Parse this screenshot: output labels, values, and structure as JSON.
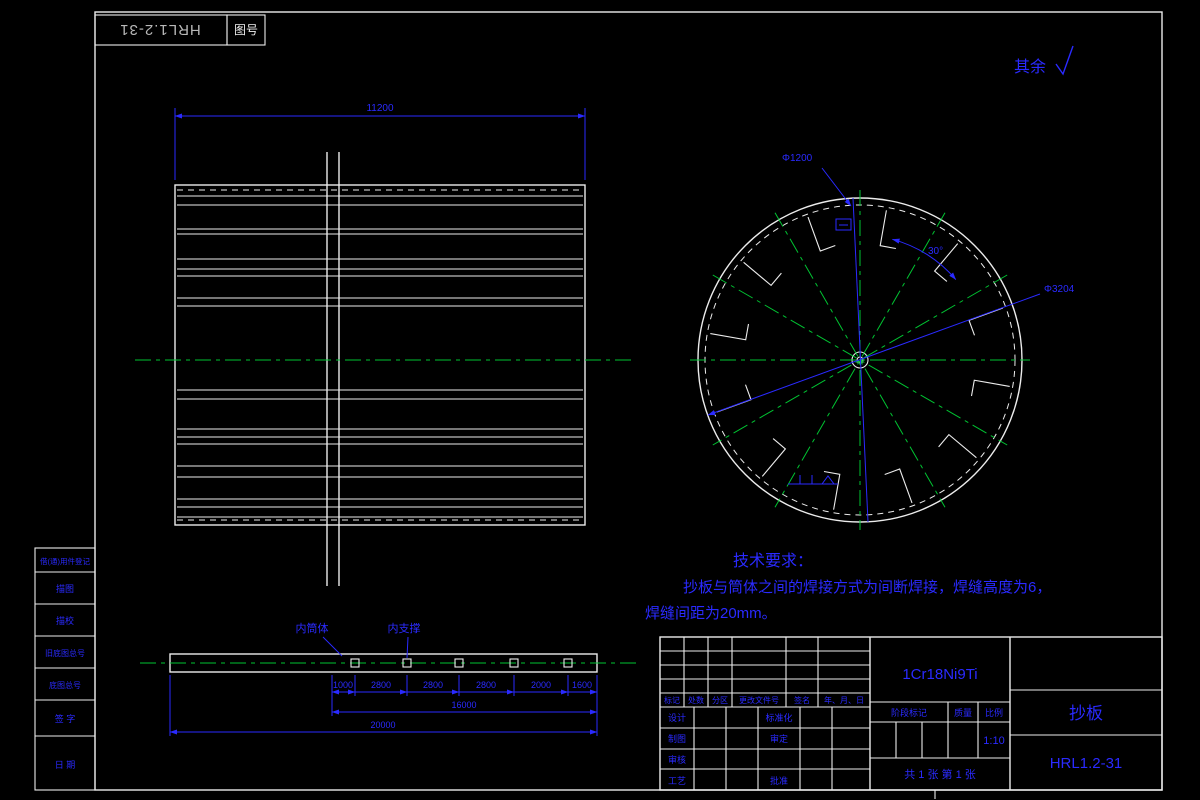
{
  "colors": {
    "background": "#000000",
    "line_white": "#ececec",
    "dim_blue": "#2a2aff",
    "centerline_green": "#00c432",
    "mirror_gray": "#b8b8b8"
  },
  "header": {
    "mirrored_drawing_no": "HRL1.2-31",
    "drawing_no_label": "图号",
    "surface_note": "其余"
  },
  "left_strip": {
    "items": [
      "借(通)用件登记",
      "描图",
      "描校",
      "旧底图总号",
      "底图总号",
      "签 字",
      "日 期"
    ]
  },
  "front_view": {
    "width_dim": "11200"
  },
  "end_view": {
    "dia_top": "Φ1200",
    "dia_main": "Φ3204",
    "angle_dim": "30°"
  },
  "section_view": {
    "label_shell": "内筒体",
    "label_support": "内支撑",
    "dims": [
      "1000",
      "2800",
      "2800",
      "2800",
      "2000",
      "1600"
    ],
    "dim_total_inner": "16000",
    "dim_total": "20000"
  },
  "tech_requirements": {
    "title": "技术要求：",
    "line1": "抄板与筒体之间的焊接方式为间断焊接，焊缝高度为6，",
    "line2": "焊缝间距为20mm。"
  },
  "title_block": {
    "material": "1Cr18Ni9Ti",
    "part_name": "抄板",
    "drawing_no": "HRL1.2-31",
    "rev_headers": [
      "标记",
      "处数",
      "分区",
      "更改文件号",
      "签名",
      "年、月、日"
    ],
    "sign_rows": [
      "设计",
      "制图",
      "审核",
      "工艺"
    ],
    "approve_rows": [
      "标准化",
      "审定",
      "批准"
    ],
    "stage_label": "阶段标记",
    "mass_label": "质量",
    "scale_label": "比例",
    "scale_value": "1:10",
    "sheet_info": "共 1 张 第 1 张"
  }
}
